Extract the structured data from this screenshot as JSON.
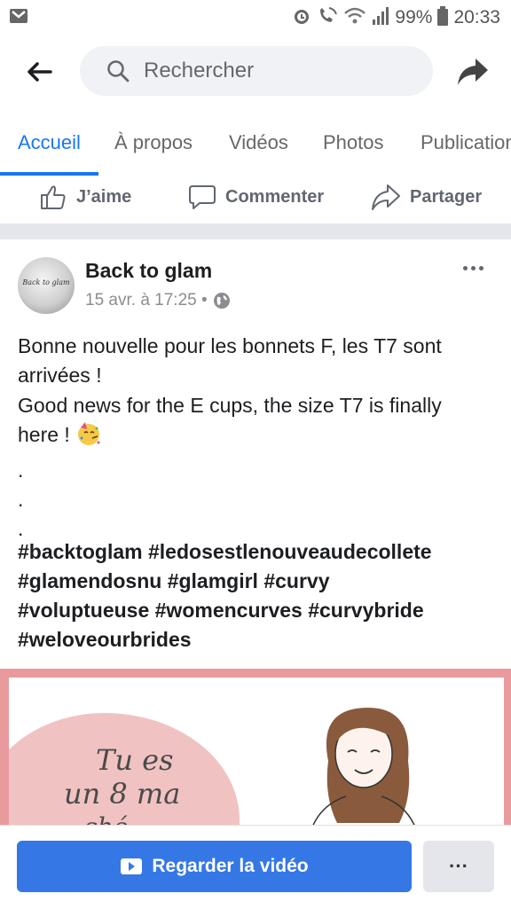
{
  "status_bar": {
    "battery": "99%",
    "time": "20:33",
    "icons": [
      "gmail-icon",
      "alarm-icon",
      "wifi-call-icon",
      "wifi-icon",
      "signal-icon",
      "battery-icon"
    ]
  },
  "topbar": {
    "search_placeholder": "Rechercher",
    "icons": [
      "back-arrow-icon",
      "search-icon",
      "share-icon"
    ]
  },
  "tabs": [
    {
      "label": "Accueil",
      "active": true
    },
    {
      "label": "À propos",
      "active": false
    },
    {
      "label": "Vidéos",
      "active": false
    },
    {
      "label": "Photos",
      "active": false
    },
    {
      "label": "Publications",
      "active": false
    }
  ],
  "actions": {
    "like": "J’aime",
    "comment": "Commenter",
    "share": "Partager"
  },
  "post": {
    "author": "Back to glam",
    "avatar_text": "Back to glam",
    "timestamp": "15 avr. à 17:25 •",
    "body_lines": [
      "Bonne nouvelle pour les bonnets F, les T7 sont",
      "arrivées !",
      "Good news for the E cups, the size T7 is finally",
      "here !",
      ".",
      ".",
      "."
    ],
    "hashtag_lines": [
      "#backtoglam #ledosestlenouveaudecollete",
      "#glamendosnu #glamgirl #curvy",
      "#voluptueuse #womencurves #curvybride",
      "#weloveourbrides"
    ],
    "video_text": [
      "Tu es",
      "un 8 ma",
      "ché..."
    ]
  },
  "bottom": {
    "watch_label": "Regarder la vidéo",
    "more_label": "···"
  },
  "colors": {
    "accent": "#1877f2",
    "button": "#3578e5",
    "video_border": "#e89a9c"
  }
}
